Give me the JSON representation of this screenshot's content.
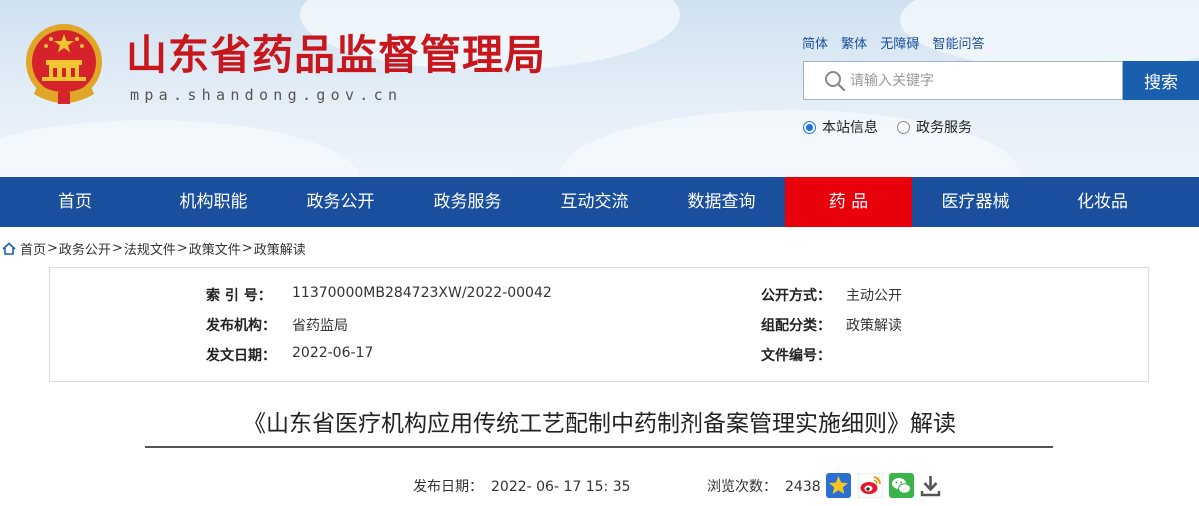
{
  "header": {
    "site_title": "山东省药品监督管理局",
    "site_domain": "mpa.shandong.gov.cn",
    "top_links": [
      "简体",
      "繁体",
      "无障碍",
      "智能问答"
    ],
    "search": {
      "placeholder": "请输入关键字",
      "button": "搜索"
    },
    "scope_options": [
      {
        "label": "本站信息",
        "selected": true
      },
      {
        "label": "政务服务",
        "selected": false
      }
    ]
  },
  "nav": {
    "items": [
      "首页",
      "机构职能",
      "政务公开",
      "政务服务",
      "互动交流",
      "数据查询",
      "药 品",
      "医疗器械",
      "化妆品"
    ],
    "active": "药 品",
    "colors": {
      "bar": "#1a4f9e",
      "active": "#e8000b"
    }
  },
  "breadcrumb": [
    "首页",
    "政务公开",
    "法规文件",
    "政策文件",
    "政策解读"
  ],
  "meta": {
    "index_label": "索 引 号：",
    "index_value": "11370000MB284723XW/2022-00042",
    "publish_mode_label": "公开方式：",
    "publish_mode_value": "主动公开",
    "issuer_label": "发布机构：",
    "issuer_value": "省药监局",
    "category_label": "组配分类：",
    "category_value": "政策解读",
    "date_label": "发文日期：",
    "date_value": "2022-06-17",
    "doc_no_label": "文件编号：",
    "doc_no_value": ""
  },
  "article": {
    "title": "《山东省医疗机构应用传统工艺配制中药制剂备案管理实施细则》解读",
    "publish_label": "发布日期：",
    "publish_value": "2022- 06- 17 15: 35",
    "views_label": "浏览次数：",
    "views_value": "2438"
  },
  "share_icons": [
    "qzone-star-icon",
    "weibo-icon",
    "wechat-icon",
    "download-icon"
  ]
}
